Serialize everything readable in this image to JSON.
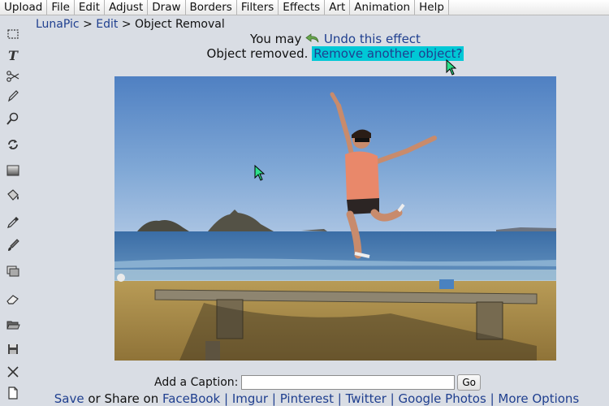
{
  "menu": [
    "Upload",
    "File",
    "Edit",
    "Adjust",
    "Draw",
    "Borders",
    "Filters",
    "Effects",
    "Art",
    "Animation",
    "Help"
  ],
  "breadcrumb": {
    "root": "LunaPic",
    "sep1": ">",
    "section": "Edit",
    "sep2": ">",
    "current": "Object Removal"
  },
  "notice": {
    "line1_prefix": "You may",
    "undo_link": "Undo this effect",
    "line2_prefix": "Object removed.",
    "again_link": "Remove another object?"
  },
  "caption": {
    "label": "Add a Caption:",
    "value": "",
    "go_label": "Go"
  },
  "share": {
    "save": "Save",
    "middle": "or Share on",
    "links": [
      "FaceBook",
      "Imgur",
      "Pinterest",
      "Twitter",
      "Google Photos",
      "More Options"
    ],
    "separator": "|"
  },
  "toolbar_icons": [
    "marquee-select-icon",
    "text-icon",
    "scissors-icon",
    "pencil-icon",
    "magnifier-icon",
    "rotate-icon",
    "gradient-icon",
    "paint-bucket-icon",
    "eyedropper-icon",
    "brush-icon",
    "layers-icon",
    "eraser-icon",
    "open-folder-icon",
    "save-disk-icon",
    "close-x-icon",
    "new-page-icon"
  ],
  "colors": {
    "background": "#d9dde4",
    "link": "#1f3f8f",
    "highlight": "#00c8d6",
    "cursor": "#2ee08a"
  }
}
